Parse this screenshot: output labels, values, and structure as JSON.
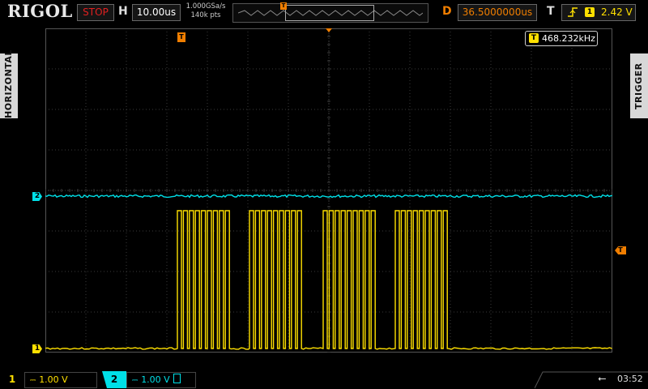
{
  "brand": {
    "logo_text": "RIGOL"
  },
  "topbar": {
    "run_status": "STOP",
    "horizontal_label": "H",
    "timebase": "10.00us",
    "sample_rate": "1.000GSa/s",
    "memory_depth": "140k pts",
    "trigger_position_marker": "T",
    "delay_label": "D",
    "delay_value": "36.5000000us",
    "trigger_label": "T",
    "trigger_edge_icon": "rising-edge-icon",
    "trigger_source": "1",
    "trigger_level": "2.42 V"
  },
  "side_tabs": {
    "left": "HORIZONTAL",
    "right": "TRIGGER"
  },
  "measurement": {
    "icon_label": "T",
    "frequency": "468.232kHz"
  },
  "markers": {
    "ch1": "1",
    "ch2": "2",
    "trigger_position": "T",
    "trigger_level": "T"
  },
  "channels": [
    {
      "number": "1",
      "coupling_icon": "dc-coupling-icon",
      "scale": "1.00 V",
      "color": "#ffe000",
      "active": false
    },
    {
      "number": "2",
      "coupling_icon": "dc-coupling-icon",
      "scale": "1.00 V",
      "color": "#00e0e8",
      "active": true
    }
  ],
  "status": {
    "usb_icon": "usb-icon",
    "time": "03:52"
  },
  "colors": {
    "ch1": "#ffe000",
    "ch2": "#00e0e8",
    "trigger": "#f07e00",
    "grid": "#3a3a3a"
  }
}
